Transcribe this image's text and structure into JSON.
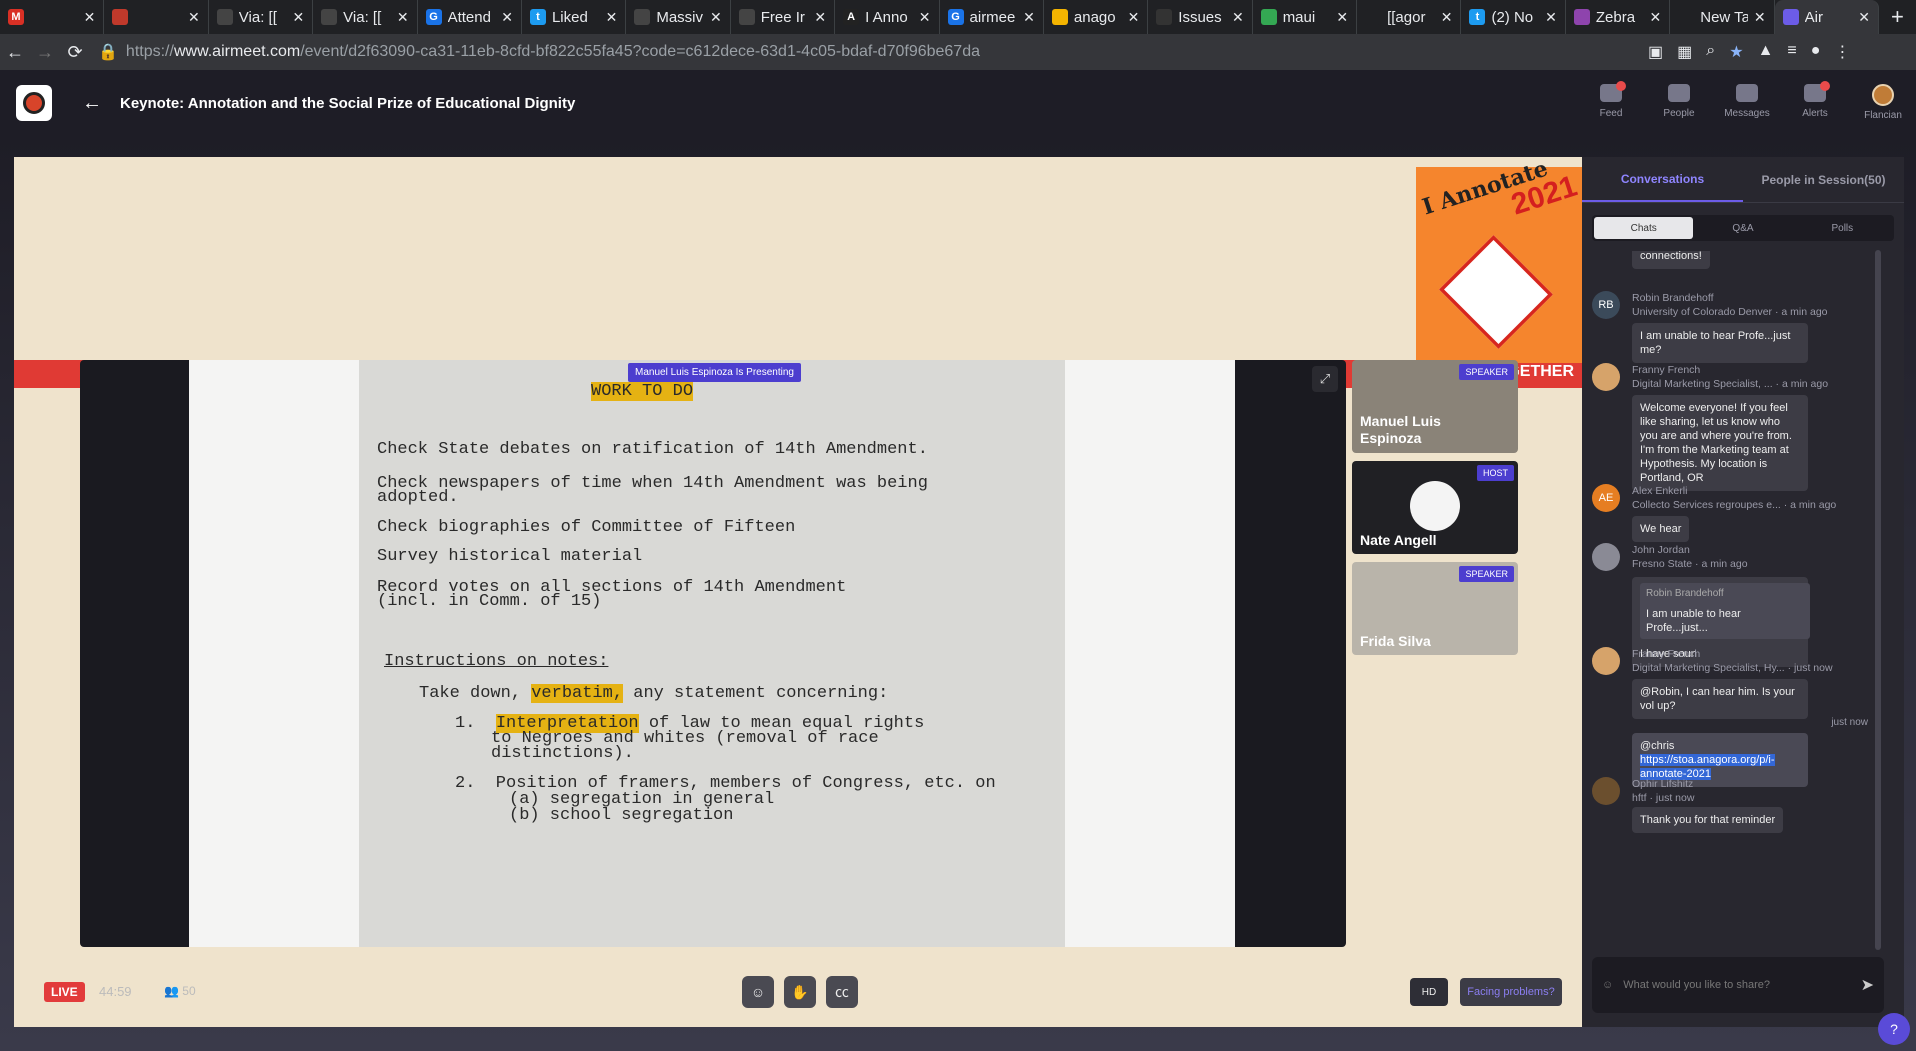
{
  "browser": {
    "tabs": [
      {
        "label": "",
        "fav": "M",
        "color": "#d93025"
      },
      {
        "label": "",
        "fav": "",
        "color": "#c0392b"
      },
      {
        "label": "Via: [[",
        "fav": "",
        "color": "#444"
      },
      {
        "label": "Via: [[",
        "fav": "",
        "color": "#444"
      },
      {
        "label": "Attend",
        "fav": "G",
        "color": "#1a73e8"
      },
      {
        "label": "Liked",
        "fav": "t",
        "color": "#1d9bf0"
      },
      {
        "label": "Massiv",
        "fav": "",
        "color": "#444"
      },
      {
        "label": "Free Ir",
        "fav": "",
        "color": "#444"
      },
      {
        "label": "I Anno",
        "fav": "A",
        "color": "#222"
      },
      {
        "label": "airmee",
        "fav": "G",
        "color": "#1a73e8"
      },
      {
        "label": "anago",
        "fav": "",
        "color": "#f4b400"
      },
      {
        "label": "Issues",
        "fav": "",
        "color": "#333"
      },
      {
        "label": "maui",
        "fav": "",
        "color": "#34a853"
      },
      {
        "label": "[[agor",
        "fav": "",
        "color": "#202124"
      },
      {
        "label": "(2) No",
        "fav": "t",
        "color": "#1d9bf0"
      },
      {
        "label": "Zebra",
        "fav": "",
        "color": "#8e44ad"
      },
      {
        "label": "New Tab",
        "fav": "",
        "color": "#202124"
      },
      {
        "label": "Air",
        "fav": "",
        "color": "#6c5ce7"
      }
    ],
    "url_scheme": "https://",
    "url_host": "www.airmeet.com",
    "url_path": "/event/d2f63090-ca31-11eb-8cfd-bf822c55fa45?code=c612dece-63d1-4c05-bdaf-d70f96be67da"
  },
  "app": {
    "title": "Keynote: Annotation and the Social Prize of Educational Dignity",
    "nav": [
      {
        "label": "Feed",
        "dot": true
      },
      {
        "label": "People",
        "dot": false
      },
      {
        "label": "Messages",
        "dot": false
      },
      {
        "label": "Alerts",
        "dot": true
      },
      {
        "label": "Flancian",
        "dot": false
      }
    ]
  },
  "stage": {
    "banner_text": "GETHER",
    "badge_title": "I Annotate",
    "badge_year": "2021",
    "presenting_label": "Manuel Luis Espinoza Is Presenting",
    "document": {
      "heading": "WORK TO DO",
      "items": [
        "Check State debates on ratification of 14th Amendment.",
        "Check newspapers of time when 14th Amendment was being",
        "adopted.",
        "Check biographies of Committee of Fifteen",
        "Survey historical material",
        "Record votes on all sections of 14th Amendment",
        "(incl. in Comm. of 15)"
      ],
      "notes_heading": "Instructions on notes:",
      "notes_intro_a": "Take down, ",
      "notes_intro_hl": "verbatim,",
      "notes_intro_b": " any statement concerning:",
      "n1_hl": "Interpretation",
      "n1_a": " of law to mean equal rights",
      "n1_b": "to Negroes and whites (removal of race",
      "n1_c": "distinctions).",
      "n2_a": "2.  Position of framers, members of Congress, etc. on",
      "n2_b": "(a) segregation in general",
      "n2_c": "(b) school segregation"
    },
    "participants": [
      {
        "name": "Manuel Luis Espinoza",
        "role": "SPEAKER"
      },
      {
        "name": "Nate Angell",
        "role": "HOST"
      },
      {
        "name": "Frida Silva",
        "role": "SPEAKER"
      }
    ],
    "live_label": "LIVE",
    "timer": "44:59",
    "viewer_count": "50",
    "hd_label": "HD",
    "facing_problems": "Facing problems?"
  },
  "sidebar": {
    "tabs": [
      "Conversations",
      "People in Session(50)"
    ],
    "segments": [
      "Chats",
      "Q&A",
      "Polls"
    ],
    "messages": [
      {
        "initials": "",
        "avatar_color": "#3d3c45",
        "name": "",
        "meta": "",
        "text": "connections!"
      },
      {
        "initials": "RB",
        "avatar_color": "#3b4a5a",
        "name": "Robin Brandehoff",
        "meta": "University of Colorado Denver · a min ago",
        "text": "I am unable to hear Profe...just me?"
      },
      {
        "initials": "",
        "avatar_color": "#d6a36a",
        "name": "Franny French",
        "meta": "Digital Marketing Specialist, ... · a min ago",
        "text": "Welcome everyone! If you feel like sharing, let us know who you are and where you're from. I'm from the Marketing team at Hypothesis. My location is Portland, OR"
      },
      {
        "initials": "AE",
        "avatar_color": "#e67e22",
        "name": "Alex Enkerli",
        "meta": "Collecto Services regroupes e... · a min ago",
        "text": "We hear"
      },
      {
        "initials": "",
        "avatar_color": "#8a8a95",
        "name": "John Jordan",
        "meta": "Fresno State · a min ago",
        "quote_name": "Robin Brandehoff",
        "quote_text": "I am unable to hear Profe...just...",
        "text": "I have soun"
      },
      {
        "initials": "",
        "avatar_color": "#d6a36a",
        "name": "Franny French",
        "meta": "Digital Marketing Specialist, Hy... · just now",
        "text": "@Robin, I can hear him. Is your vol up?"
      },
      {
        "own": true,
        "meta": "just now",
        "mention": "@chris ",
        "link": "https://stoa.anagora.org/p/i-annotate-2021"
      },
      {
        "initials": "",
        "avatar_color": "#6b4f2e",
        "name": "Ophir Lifshitz",
        "meta": "hftf · just now",
        "text": "Thank you for that reminder"
      }
    ],
    "input_placeholder": "What would you like to share?"
  }
}
